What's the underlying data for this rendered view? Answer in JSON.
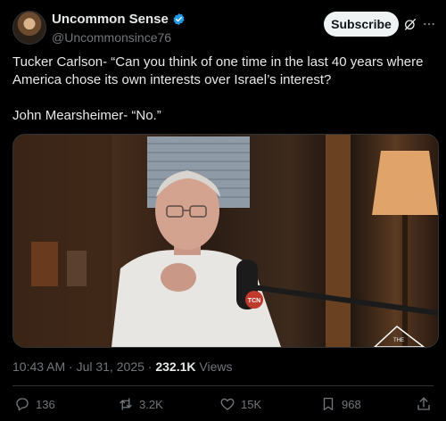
{
  "author": {
    "display_name": "Uncommon Sense",
    "handle": "@Uncommonsince76",
    "verified": true
  },
  "header": {
    "subscribe_label": "Subscribe"
  },
  "tweet": {
    "paragraphs": [
      "Tucker Carlson- “Can you think of one time in the last 40 years where America chose its own interests over Israel’s interest?",
      "John Mearsheimer- “No.”"
    ]
  },
  "media": {
    "kind": "video",
    "mic_badge": "TCN",
    "watermark": "THE"
  },
  "meta": {
    "time": "10:43 AM",
    "separator": " · ",
    "date": "Jul 31, 2025",
    "views_count": "232.1K",
    "views_label": "Views"
  },
  "actions": {
    "replies": "136",
    "reposts": "3.2K",
    "likes": "15K",
    "bookmarks": "968"
  },
  "colors": {
    "background": "#000000",
    "text": "#e7e9ea",
    "secondary": "#71767b",
    "verified": "#1d9bf0",
    "subscribe_bg": "#eff3f4"
  }
}
